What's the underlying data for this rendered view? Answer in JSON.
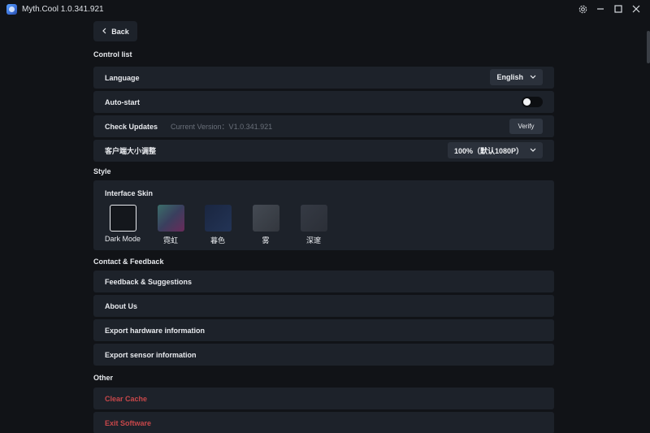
{
  "window": {
    "title": "Myth.Cool  1.0.341.921",
    "icons": [
      "settings-icon",
      "minimize-icon",
      "maximize-icon",
      "close-icon"
    ]
  },
  "back_label": "Back",
  "control_list": {
    "heading": "Control list",
    "language": {
      "label": "Language",
      "value": "English"
    },
    "autostart": {
      "label": "Auto-start",
      "enabled": false
    },
    "updates": {
      "label": "Check Updates",
      "version_text": "Current Version：V1.0.341.921",
      "button": "Verify"
    },
    "client_size": {
      "label": "客户端大小调整",
      "value": "100%（默认1080P）"
    }
  },
  "style": {
    "heading": "Style",
    "skin_title": "Interface Skin",
    "skins": [
      {
        "label": "Dark Mode",
        "selected": true,
        "color": "#14171c"
      },
      {
        "label": "霓虹",
        "selected": false,
        "color": "#3a4a5e"
      },
      {
        "label": "暮色",
        "selected": false,
        "color": "#1d2a44"
      },
      {
        "label": "雾",
        "selected": false,
        "color": "#3a3f48"
      },
      {
        "label": "深邃",
        "selected": false,
        "color": "#2e323b"
      }
    ]
  },
  "contact": {
    "heading": "Contact & Feedback",
    "items": [
      "Feedback & Suggestions",
      "About Us",
      "Export hardware information",
      "Export sensor information"
    ]
  },
  "other": {
    "heading": "Other",
    "items": [
      "Clear Cache",
      "Exit Software"
    ]
  },
  "colors": {
    "background": "#111317",
    "row": "#1d222a",
    "danger": "#c8474a"
  }
}
